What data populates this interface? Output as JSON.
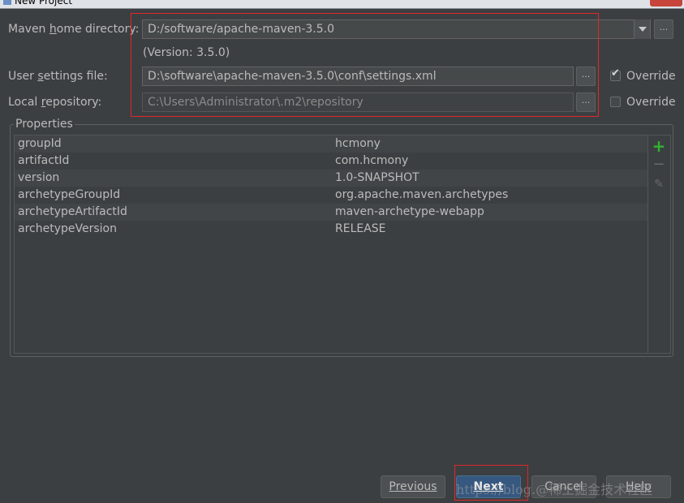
{
  "window": {
    "title": "New Project"
  },
  "maven_home": {
    "label_prefix": "Maven ",
    "label_mnemonic": "h",
    "label_suffix": "ome directory:",
    "value": "D:/software/apache-maven-3.5.0",
    "version_text": "(Version: 3.5.0)"
  },
  "user_settings": {
    "label_prefix": "User ",
    "label_mnemonic": "s",
    "label_suffix": "ettings file:",
    "value": "D:\\software\\apache-maven-3.5.0\\conf\\settings.xml",
    "override_label": "Override",
    "override_checked": true
  },
  "local_repository": {
    "label_prefix": "Local ",
    "label_mnemonic": "r",
    "label_suffix": "epository:",
    "value": "C:\\Users\\Administrator\\.m2\\repository",
    "override_label": "Override",
    "override_checked": false
  },
  "browse_label": "...",
  "properties": {
    "legend": "Properties",
    "rows": [
      {
        "key": "groupId",
        "value": "hcmony"
      },
      {
        "key": "artifactId",
        "value": "com.hcmony"
      },
      {
        "key": "version",
        "value": "1.0-SNAPSHOT"
      },
      {
        "key": "archetypeGroupId",
        "value": "org.apache.maven.archetypes"
      },
      {
        "key": "archetypeArtifactId",
        "value": "maven-archetype-webapp"
      },
      {
        "key": "archetypeVersion",
        "value": "RELEASE"
      }
    ],
    "toolbar_icons": [
      "plus-icon",
      "minus-icon",
      "pencil-icon"
    ]
  },
  "buttons": {
    "previous": "Previous",
    "next": "Next",
    "cancel": "Cancel",
    "help": "Help"
  },
  "watermark": "https://blog.@稀土掘金技术社区",
  "colors": {
    "background": "#3c3f41",
    "highlight": "#e0272c",
    "add_icon": "#2fb52f",
    "default_button": "#365880"
  }
}
